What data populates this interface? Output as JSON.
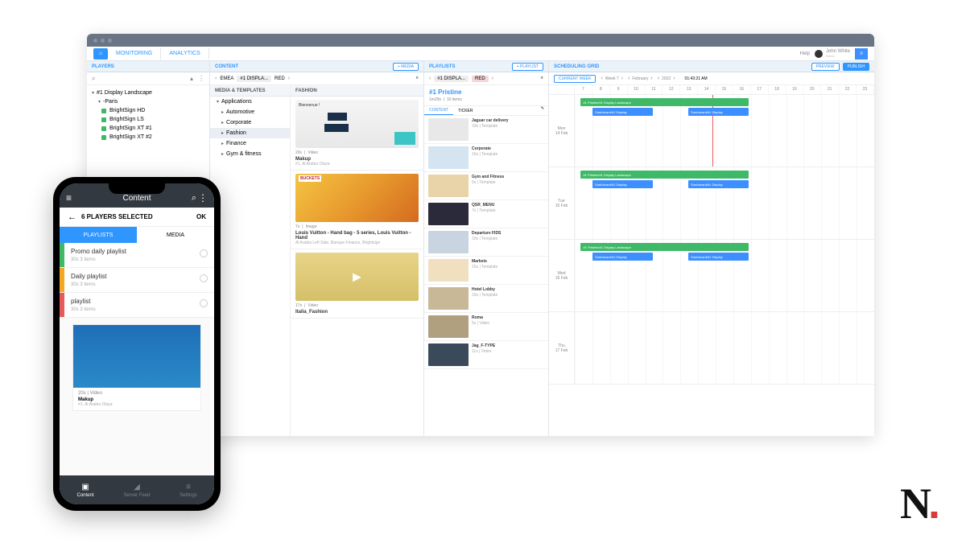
{
  "nav": {
    "monitoring": "MONITORING",
    "analytics": "ANALYTICS",
    "help": "Help",
    "user_name": "John White",
    "user_sub": "Demo"
  },
  "players": {
    "title": "PLAYERS",
    "root": "#1 Display Landscape",
    "paris": "-Paris",
    "items": [
      {
        "name": "BrightSign HD",
        "color": "#3fb968"
      },
      {
        "name": "BrightSign LS",
        "color": "#3fb968"
      },
      {
        "name": "BrightSign XT #1",
        "color": "#3fb968"
      },
      {
        "name": "BrightSign XT #2",
        "color": "#3fb968"
      }
    ]
  },
  "content": {
    "title": "CONTENT",
    "add_btn": "+ MEDIA",
    "breadcrumb": [
      "EMEA",
      "#1 DISPLA...",
      "RED"
    ],
    "mt_header": "MEDIA & TEMPLATES",
    "fashion_header": "FASHION",
    "tree": {
      "apps": "Applications",
      "items": [
        "Automotive",
        "Corporate",
        "Fashion",
        "Finance",
        "Gym & fitness"
      ]
    },
    "media": [
      {
        "duration": "20s",
        "type": "Video",
        "title": "Makup",
        "sub": "#1, Al Arabia Olaya",
        "welcome": "Bienvenue !"
      },
      {
        "duration": "7s",
        "type": "Image",
        "title": "Louis Vuitton - Hand bag - 5 series, Louis Vuitton - Hand",
        "sub": "Al Arabia Left Side, Banque Finance, Brightsign",
        "bucket": "BUCKETS"
      },
      {
        "duration": "17s",
        "type": "Video",
        "title": "Italia_Fashion",
        "sub": ""
      }
    ]
  },
  "playlists": {
    "title": "PLAYLISTS",
    "add_btn": "+ PLAYLIST",
    "breadcrumb": [
      "#1 DISPLA...",
      "RED"
    ],
    "name": "#1 Pristine",
    "duration": "1m29s",
    "count": "10 items",
    "tab_content": "CONTENT",
    "tab_ticker": "TICKER",
    "items": [
      {
        "name": "Jaguar car delivery",
        "meta": "19s | Template"
      },
      {
        "name": "Corporate",
        "meta": "10s | Template"
      },
      {
        "name": "Gym and Fitness",
        "meta": "5s | Template"
      },
      {
        "name": "QSR_MENU",
        "meta": "7s | Template"
      },
      {
        "name": "Departure FIDS",
        "meta": "10s | Template"
      },
      {
        "name": "Markets",
        "meta": "15s | Template"
      },
      {
        "name": "Hotel Lobby",
        "meta": "15s | Template"
      },
      {
        "name": "Roma",
        "meta": "5s | Video"
      },
      {
        "name": "Jag_F-TYPE",
        "meta": "11s | Video"
      }
    ]
  },
  "sched": {
    "title": "SCHEDULING GRID",
    "preview": "PREVIEW",
    "publish": "PUBLISH",
    "current_week": "CURRENT WEEK",
    "week": "Week 7",
    "month": "February",
    "year": "2022",
    "time": "01:43:21 AM",
    "hours": [
      "7",
      "8",
      "9",
      "10",
      "11",
      "12",
      "13",
      "14",
      "15",
      "16",
      "17",
      "18",
      "19",
      "20",
      "21",
      "22",
      "23"
    ],
    "days": [
      {
        "dow": "Mon",
        "date": "14 Feb"
      },
      {
        "dow": "Tue",
        "date": "15 Feb"
      },
      {
        "dow": "Wed",
        "date": "16 Feb"
      },
      {
        "dow": "Thu",
        "date": "17 Feb"
      }
    ],
    "ev_green": "#1 Pristine/#1 Display Landscape",
    "ev_blue1": "Dashboard/#1 Display",
    "ev_blue2": "Dashboard/#1 Display"
  },
  "phone": {
    "header": "Content",
    "sel_header": "6 PLAYERS SELECTED",
    "ok": "OK",
    "tab_pl": "PLAYLISTS",
    "tab_media": "MEDIA",
    "playlists": [
      {
        "name": "Promo daily playlist",
        "meta": "30s    3 items",
        "color": "#3fb968"
      },
      {
        "name": "Daily playlist",
        "meta": "30s    3 items",
        "color": "#f5a623"
      },
      {
        "name": "playlist",
        "meta": "30s    3 items",
        "color": "#e85a5a"
      }
    ],
    "media": {
      "meta": "20s | Video",
      "title": "Makup",
      "sub": "#1, Al Arabia Olaya"
    },
    "bottom": [
      "Content",
      "Server Feed",
      "Settings"
    ]
  }
}
